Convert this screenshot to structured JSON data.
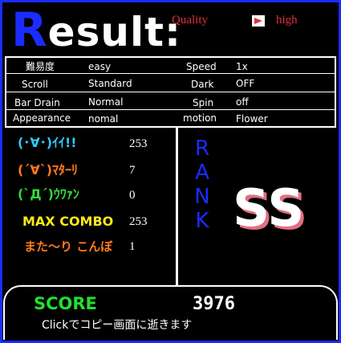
{
  "title": {
    "first_letter": "R",
    "rest": "esult:"
  },
  "quality": {
    "label": "Quality",
    "value": "high",
    "indicator_color": "#e0303b"
  },
  "options": [
    {
      "label": "難易度",
      "value": "easy",
      "label2": "Speed",
      "value2": "1x"
    },
    {
      "label": "Scroll",
      "value": "Standard",
      "label2": "Dark",
      "value2": "OFF"
    },
    {
      "label": "Bar Drain",
      "value": "Normal",
      "label2": "Spin",
      "value2": "off"
    },
    {
      "label": "Appearance",
      "value": "nomal",
      "label2": "motion",
      "value2": "Flower"
    }
  ],
  "judges": [
    {
      "label": "(･∀･)ｲｲ!!",
      "count": "253",
      "color": "#33c8ff"
    },
    {
      "label": "(´∀`)ﾏﾀｰﾘ",
      "count": "7",
      "color": "#ff7a1a"
    },
    {
      "label": "(`Д´)ｳﾜｧﾝ",
      "count": "0",
      "color": "#33d83a"
    },
    {
      "label": "MAX COMBO",
      "count": "253",
      "color": "#ffe81a"
    },
    {
      "label": "また～り こんぼ",
      "count": "1",
      "color": "#ff7a1a"
    }
  ],
  "rank": {
    "letters": [
      "R",
      "A",
      "N",
      "K"
    ],
    "value": "SS"
  },
  "score": {
    "label": "SCORE",
    "value": "3976"
  },
  "footer": {
    "message": "Clickでコピー画面に逝きます"
  },
  "colors": {
    "border": "#1a2cff",
    "title_blue": "#1a2cff",
    "rank_shadow": "#e07080"
  }
}
